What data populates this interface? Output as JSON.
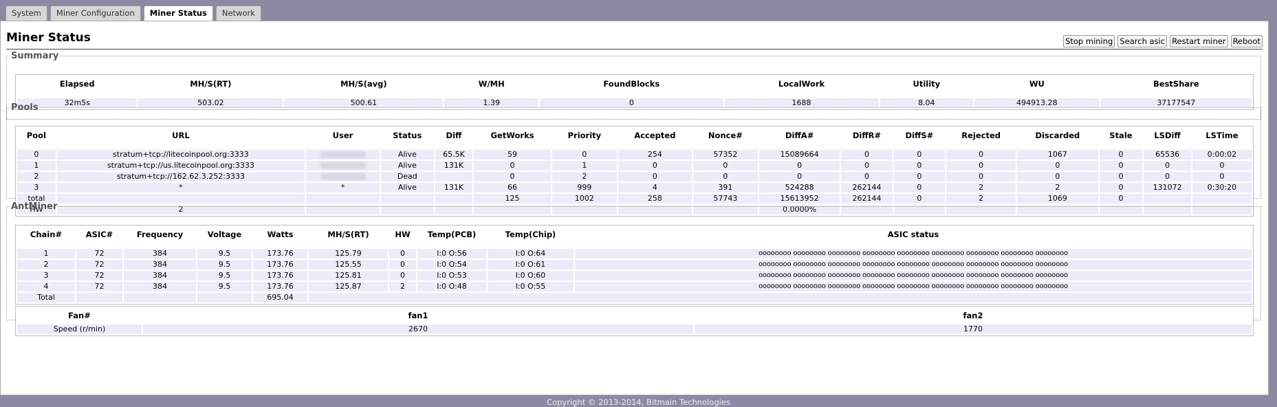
{
  "tabs": [
    "System",
    "Miner Configuration",
    "Miner Status",
    "Network"
  ],
  "active_tab": "Miner Status",
  "page_title": "Miner Status",
  "buttons": {
    "stop": "Stop mining",
    "search": "Search asic",
    "restart": "Restart miner",
    "reboot": "Reboot"
  },
  "summary": {
    "legend": "Summary",
    "headers": [
      "Elapsed",
      "MH/S(RT)",
      "MH/S(avg)",
      "W/MH",
      "FoundBlocks",
      "LocalWork",
      "Utility",
      "WU",
      "BestShare"
    ],
    "row": [
      "32m5s",
      "503.02",
      "500.61",
      "1.39",
      "0",
      "1688",
      "8.04",
      "494913.28",
      "37177547"
    ]
  },
  "pools": {
    "legend": "Pools",
    "headers": [
      "Pool",
      "URL",
      "User",
      "Status",
      "Diff",
      "GetWorks",
      "Priority",
      "Accepted",
      "Nonce#",
      "DiffA#",
      "DiffR#",
      "DiffS#",
      "Rejected",
      "Discarded",
      "Stale",
      "LSDiff",
      "LSTime"
    ],
    "rows": [
      [
        "0",
        "stratum+tcp://litecoinpool.org:3333",
        "",
        "Alive",
        "65.5K",
        "59",
        "0",
        "254",
        "57352",
        "15089664",
        "0",
        "0",
        "0",
        "1067",
        "0",
        "65536",
        "0:00:02"
      ],
      [
        "1",
        "stratum+tcp://us.litecoinpool.org:3333",
        "",
        "Alive",
        "131K",
        "0",
        "1",
        "0",
        "0",
        "0",
        "0",
        "0",
        "0",
        "0",
        "0",
        "0",
        "0"
      ],
      [
        "2",
        "stratum+tcp://162.62.3.252:3333",
        "",
        "Dead",
        "",
        "0",
        "2",
        "0",
        "0",
        "0",
        "0",
        "0",
        "0",
        "0",
        "0",
        "0",
        "0"
      ],
      [
        "3",
        "*",
        "*",
        "Alive",
        "131K",
        "66",
        "999",
        "4",
        "391",
        "524288",
        "262144",
        "0",
        "2",
        "2",
        "0",
        "131072",
        "0:30:20"
      ],
      [
        "total",
        "",
        "",
        "",
        "",
        "125",
        "1002",
        "258",
        "57743",
        "15613952",
        "262144",
        "0",
        "2",
        "1069",
        "0",
        "",
        ""
      ],
      [
        "HW",
        "2",
        "",
        "",
        "",
        "",
        "",
        "",
        "",
        "0.0000%",
        "",
        "",
        "",
        "",
        "",
        "",
        ""
      ]
    ]
  },
  "antminer": {
    "legend": "AntMiner",
    "headers": [
      "Chain#",
      "ASIC#",
      "Frequency",
      "Voltage",
      "Watts",
      "MH/S(RT)",
      "HW",
      "Temp(PCB)",
      "Temp(Chip)",
      "ASIC status"
    ],
    "rows": [
      [
        "1",
        "72",
        "384",
        "9.5",
        "173.76",
        "125.79",
        "0",
        "I:0 O:56",
        "I:0 O:64",
        "oooooooo oooooooo oooooooo oooooooo oooooooo oooooooo oooooooo oooooooo oooooooo"
      ],
      [
        "2",
        "72",
        "384",
        "9.5",
        "173.76",
        "125.55",
        "0",
        "I:0 O:54",
        "I:0 O:61",
        "oooooooo oooooooo oooooooo oooooooo oooooooo oooooooo oooooooo oooooooo oooooooo"
      ],
      [
        "3",
        "72",
        "384",
        "9.5",
        "173.76",
        "125.81",
        "0",
        "I:0 O:53",
        "I:0 O:60",
        "oooooooo oooooooo oooooooo oooooooo oooooooo oooooooo oooooooo oooooooo oooooooo"
      ],
      [
        "4",
        "72",
        "384",
        "9.5",
        "173.76",
        "125.87",
        "2",
        "I:0 O:48",
        "I:0 O:55",
        "oooooooo oooooooo oooooooo oooooooo oooooooo oooooooo oooooooo oooooooo oooooooo"
      ]
    ],
    "total_label": "Total",
    "total_watts": "695.04",
    "fans": {
      "headers": [
        "Fan#",
        "fan1",
        "fan2"
      ],
      "row": [
        "Speed (r/min)",
        "2670",
        "1770"
      ]
    }
  },
  "footer": "Copyright © 2013-2014, Bitmain Technologies"
}
